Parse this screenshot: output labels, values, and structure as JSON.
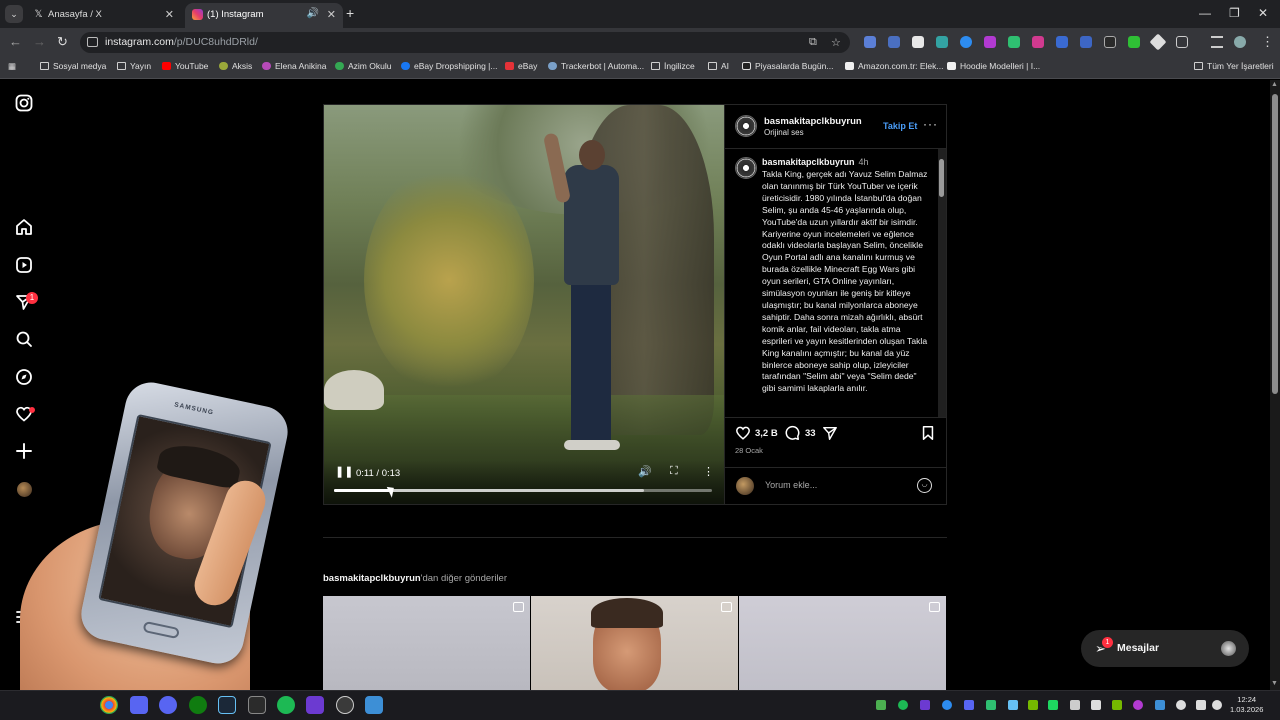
{
  "browser": {
    "tabs": [
      {
        "title": "Anasayfa / X",
        "icon": "x-logo-icon"
      },
      {
        "title": "(1) Instagram",
        "icon": "instagram-icon"
      }
    ],
    "url_host": "instagram.com",
    "url_path": "/p/DUC8uhdDRld/",
    "bookmarks": [
      "Sosyal medya",
      "Yayın",
      "YouTube",
      "Aksis",
      "Elena Anikina",
      "Azim Okulu",
      "eBay Dropshipping |...",
      "eBay",
      "Trackerbot | Automa...",
      "İngilizce",
      "AI",
      "Piyasalarda Bugün...",
      "Amazon.com.tr: Elek...",
      "Hoodie Modelleri | I...",
      "Tüm Yer İşaretleri"
    ]
  },
  "instagram": {
    "sidebar": {
      "notifications_badge": "1"
    },
    "post": {
      "username": "basmakitapclkbuyrun",
      "audio": "Orijinal ses",
      "follow_label": "Takip Et",
      "more_label": "···",
      "video": {
        "time": "0:11 / 0:13",
        "progress": 0.149,
        "buffered": 0.82
      },
      "caption": {
        "username": "basmakitapclkbuyrun",
        "time_ago": "4h",
        "text": "Takla King, gerçek adı Yavuz Selim Dalmaz olan tanınmış bir Türk YouTuber ve içerik üreticisidir. 1980 yılında İstanbul'da doğan Selim, şu anda 45-46 yaşlarında olup, YouTube'da uzun yıllardır aktif bir isimdir. Kariyerine oyun incelemeleri ve eğlence odaklı videolarla başlayan Selim, öncelikle Oyun Portal adlı ana kanalını kurmuş ve burada özellikle Minecraft Egg Wars gibi oyun serileri, GTA Online yayınları, simülasyon oyunları ile geniş bir kitleye ulaşmıştır; bu kanal milyonlarca aboneye sahiptir. Daha sonra mizah ağırlıklı, absürt komik anlar, fail videoları, takla atma esprileri ve yayın kesitlerinden oluşan Takla King kanalını açmıştır; bu kanal da yüz binlerce aboneye sahip olup, izleyiciler tarafından \"Selim abi\" veya \"Selim dede\" gibi samimi lakaplarla anılır."
      },
      "likes": "3,2 B",
      "comments": "33",
      "date": "28 Ocak",
      "comment_placeholder": "Yorum ekle..."
    },
    "more_posts_user": "basmakitapclkbuyrun",
    "more_posts_suffix": "'dan diğer gönderiler",
    "messages_label": "Mesajlar",
    "messages_badge": "1"
  },
  "overlay": {
    "phone_brand": "SAMSUNG"
  },
  "taskbar": {
    "time": "12:24",
    "date": "1.03.2026"
  }
}
